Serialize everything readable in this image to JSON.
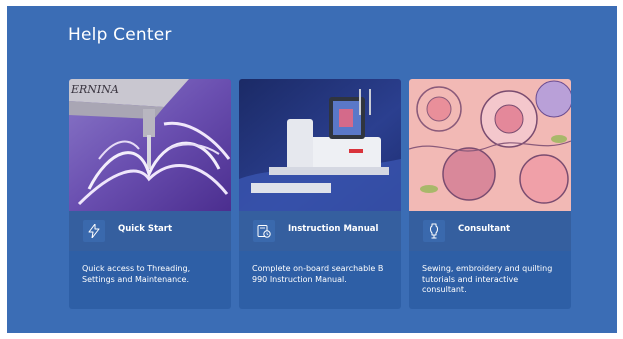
{
  "page": {
    "title": "Help Center"
  },
  "cards": [
    {
      "label": "Quick Start",
      "icon": "lightning-icon",
      "description": "Quick access to Threading, Settings and Maintenance.",
      "brand_text": "ERNINA"
    },
    {
      "label": "Instruction Manual",
      "icon": "manual-clock-icon",
      "description": "Complete on-board searchable B 990 Instruction Manual."
    },
    {
      "label": "Consultant",
      "icon": "dress-form-icon",
      "description": "Sewing, embroidery and quilting tutorials and interactive consultant."
    }
  ],
  "colors": {
    "background": "#3b6db5",
    "card": "#2e5fa6",
    "card_header": "#355f9f",
    "text": "#ffffff"
  }
}
